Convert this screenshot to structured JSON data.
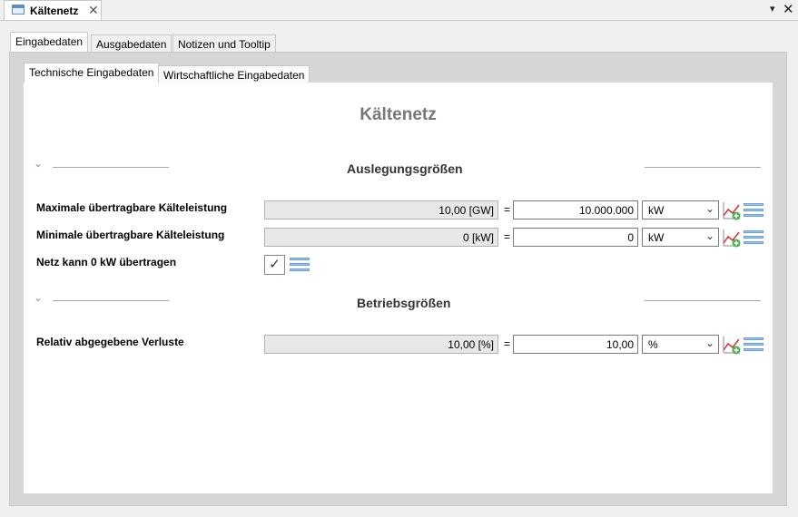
{
  "editor": {
    "tab_title": "Kältenetz",
    "close_glyph": "✕",
    "menu_glyph": "▾",
    "view_close_glyph": "✕"
  },
  "outer_tabs": [
    {
      "label": "Eingabedaten",
      "active": true
    },
    {
      "label": "Ausgabedaten",
      "active": false
    },
    {
      "label": "Notizen und Tooltip",
      "active": false
    }
  ],
  "inner_tabs": [
    {
      "label": "Technische Eingabedaten",
      "active": true
    },
    {
      "label": "Wirtschaftliche Eingabedaten",
      "active": false
    }
  ],
  "page_title": "Kältenetz",
  "sections": {
    "design": {
      "title": "Auslegungsgrößen",
      "rows": [
        {
          "label": "Maximale übertragbare Kälteleistung",
          "display": "10,00 [GW]",
          "equals": "=",
          "value": "10.000.000",
          "unit": "kW"
        },
        {
          "label": "Minimale übertragbare Kälteleistung",
          "display": "0 [kW]",
          "equals": "=",
          "value": "0",
          "unit": "kW"
        }
      ],
      "checkbox": {
        "label": "Netz kann 0 kW übertragen",
        "checked": true,
        "glyph": "✓"
      }
    },
    "operation": {
      "title": "Betriebsgrößen",
      "rows": [
        {
          "label": "Relativ abgegebene Verluste",
          "display": "10,00 [%]",
          "equals": "=",
          "value": "10,00",
          "unit": "%"
        }
      ]
    }
  },
  "icons": {
    "chevron": "⌄",
    "dropdown_arrow": "⌄",
    "chart_icon": "chart-add-icon",
    "list_icon": "list-icon"
  }
}
